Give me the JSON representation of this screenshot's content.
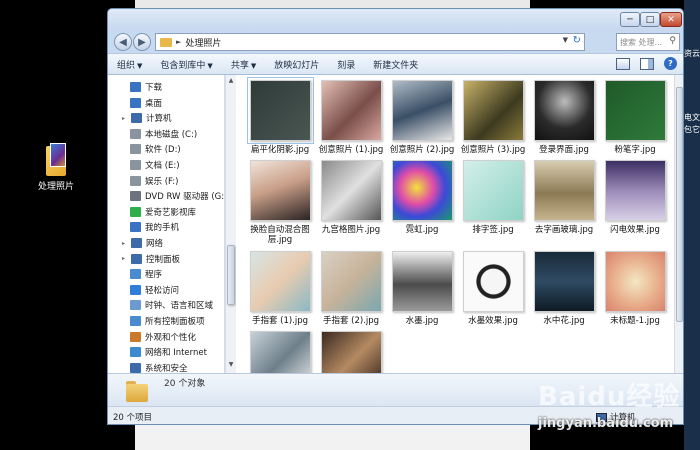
{
  "desktop": {
    "icon_label": "处理照片",
    "right_labels": [
      "资云",
      "电文",
      "包它"
    ]
  },
  "window": {
    "address": {
      "folder": "处理照片"
    },
    "search_placeholder": "搜索 处理...",
    "toolbar": {
      "organize": "组织",
      "include_in_library": "包含到库中",
      "share": "共享",
      "slideshow": "放映幻灯片",
      "burn": "刻录",
      "new_folder": "新建文件夹"
    },
    "nav": [
      {
        "label": "下载",
        "icon": "download-folder-icon",
        "color": "#3a73c4",
        "level": 1
      },
      {
        "label": "桌面",
        "icon": "desktop-icon",
        "color": "#3a73c4",
        "level": 1
      },
      {
        "label": "计算机",
        "icon": "computer-icon",
        "color": "#3d6aa8",
        "level": 0
      },
      {
        "label": "本地磁盘 (C:)",
        "icon": "drive-icon",
        "color": "#8a949f",
        "level": 1
      },
      {
        "label": "软件 (D:)",
        "icon": "drive-icon",
        "color": "#8a949f",
        "level": 1
      },
      {
        "label": "文档 (E:)",
        "icon": "drive-icon",
        "color": "#8a949f",
        "level": 1
      },
      {
        "label": "娱乐 (F:)",
        "icon": "drive-icon",
        "color": "#8a949f",
        "level": 1
      },
      {
        "label": "DVD RW 驱动器 (G:",
        "icon": "dvd-drive-icon",
        "color": "#6c737c",
        "level": 1
      },
      {
        "label": "爱奇艺影视库",
        "icon": "iqiyi-icon",
        "color": "#2fae4e",
        "level": 1
      },
      {
        "label": "我的手机",
        "icon": "phone-icon",
        "color": "#3a73c4",
        "level": 1
      },
      {
        "label": "网络",
        "icon": "network-icon",
        "color": "#3d6aa8",
        "level": 0
      },
      {
        "label": "控制面板",
        "icon": "control-panel-icon",
        "color": "#3d6aa8",
        "level": 0
      },
      {
        "label": "程序",
        "icon": "programs-icon",
        "color": "#4a8bd0",
        "level": 1
      },
      {
        "label": "轻松访问",
        "icon": "ease-of-access-icon",
        "color": "#2f7fd8",
        "level": 1
      },
      {
        "label": "时钟、语言和区域",
        "icon": "clock-icon",
        "color": "#6a9ad0",
        "level": 1
      },
      {
        "label": "所有控制面板项",
        "icon": "control-panel-icon",
        "color": "#4a8bd0",
        "level": 1
      },
      {
        "label": "外观和个性化",
        "icon": "appearance-icon",
        "color": "#c97a2a",
        "level": 1
      },
      {
        "label": "网络和 Internet",
        "icon": "network-icon",
        "color": "#3d8ad0",
        "level": 1
      },
      {
        "label": "系统和安全",
        "icon": "security-icon",
        "color": "#3d6aa8",
        "level": 1
      }
    ],
    "files": [
      {
        "name": "扁平化阴影.jpg",
        "grad": "linear-gradient(135deg,#2e3b38,#4a5652)",
        "sel": true
      },
      {
        "name": "创意照片 (1).jpg",
        "grad": "linear-gradient(135deg,#e3c0b5,#7a4e49 55%,#d9a7a0)",
        "sel": false
      },
      {
        "name": "创意照片 (2).jpg",
        "grad": "linear-gradient(160deg,#b0bcc7,#3a4f66 50%,#e8e8e8)",
        "sel": false
      },
      {
        "name": "创意照片 (3).jpg",
        "grad": "linear-gradient(135deg,#c9b26a,#3c3a1f 60%,#8a7a3a)",
        "sel": false
      },
      {
        "name": "登录界面.jpg",
        "grad": "radial-gradient(circle at 50% 35%,#bdbdbd,#2b2b2b 55%,#111)",
        "sel": false
      },
      {
        "name": "粉笔字.jpg",
        "grad": "linear-gradient(135deg,#1f5a2a,#2f7a3a)",
        "sel": false
      },
      {
        "name": "换脸自动混合图层.jpg",
        "grad": "linear-gradient(160deg,#f0e3da,#c99f88 45%,#2a2323)",
        "sel": false
      },
      {
        "name": "九宫格图片.jpg",
        "grad": "linear-gradient(135deg,#8a8a8a,#e0e0e0 50%,#555)",
        "sel": false
      },
      {
        "name": "霓虹.jpg",
        "grad": "radial-gradient(circle at 40% 45%,#f2e23a,#e04ca8 35%,#3b4ad8 60%,#1a9a6a)",
        "sel": false
      },
      {
        "name": "排字签.jpg",
        "grad": "linear-gradient(135deg,#d3efe9,#8fd3c5)",
        "sel": false
      },
      {
        "name": "去字画玻璃.jpg",
        "grad": "linear-gradient(180deg,#d8ccb0,#8b7a54 55%,#c6b48e)",
        "sel": false
      },
      {
        "name": "闪电效果.jpg",
        "grad": "linear-gradient(180deg,#3c2f63,#9b8ab8 50%,#d8d0e6)",
        "sel": false
      },
      {
        "name": "手指套 (1).jpg",
        "grad": "linear-gradient(135deg,#d6e5e4,#e9cbb0 50%,#8ab9c4)",
        "sel": false
      },
      {
        "name": "手指套 (2).jpg",
        "grad": "linear-gradient(135deg,#d9d0c3,#c7b39a 50%,#7aa8b0)",
        "sel": false
      },
      {
        "name": "水墨.jpg",
        "grad": "linear-gradient(180deg,#efefef,#4b4b4b 55%,#9b9b9b)",
        "sel": false
      },
      {
        "name": "水墨效果.jpg",
        "grad": "radial-gradient(circle at 50% 50%,#f6f6f6 30%,#222 32%,#222 40%,#fafafa 42%)",
        "sel": false
      },
      {
        "name": "水中花.jpg",
        "grad": "linear-gradient(180deg,#1a2b3a,#2f4b63 50%,#0e1a24)",
        "sel": false
      },
      {
        "name": "未标题-1.jpg",
        "grad": "radial-gradient(circle at 50% 50%,#f3e7c2,#e7a987 60%,#d9826e)",
        "sel": false
      },
      {
        "name": "",
        "grad": "linear-gradient(135deg,#c7d2d9,#6e7f8a 50%,#f0f0f0)",
        "sel": false
      },
      {
        "name": "",
        "grad": "linear-gradient(135deg,#3a2a20,#b58a62 50%,#2a1d16)",
        "sel": false
      }
    ],
    "details_text": "20 个对象",
    "status_left": "20 个项目",
    "status_right": "计算机"
  },
  "watermark": {
    "logo": "Baidu经验",
    "url": "jingyan.baidu.com"
  }
}
